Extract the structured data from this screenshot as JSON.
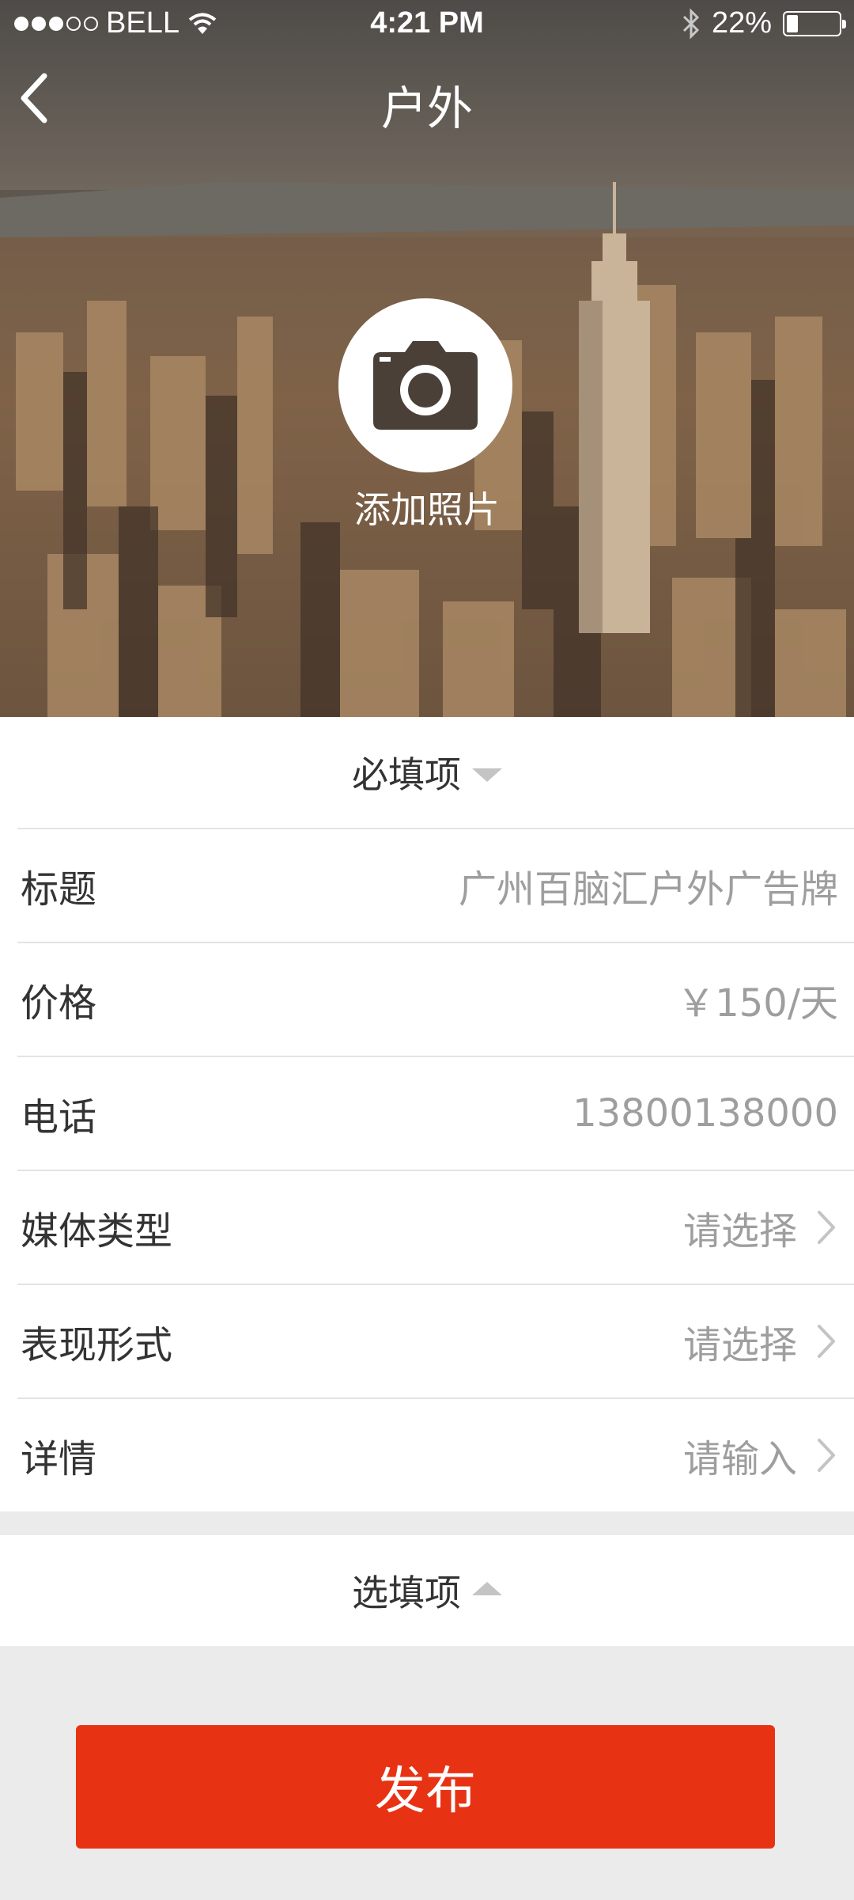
{
  "status_bar": {
    "carrier": "BELL",
    "time": "4:21 PM",
    "battery_text": "22%",
    "battery_level": 0.22,
    "signal_bars": 3,
    "icons": [
      "signal-dots-icon",
      "wifi-icon",
      "bluetooth-icon",
      "battery-icon"
    ]
  },
  "nav": {
    "title": "户外",
    "back_icon": "chevron-left-icon"
  },
  "photo": {
    "add_label": "添加照片",
    "icon": "camera-icon"
  },
  "required_section": {
    "title": "必填项",
    "toggle_icon": "triangle-down-icon",
    "fields": [
      {
        "label": "标题",
        "value": "广州百脑汇户外广告牌",
        "has_arrow": false
      },
      {
        "label": "价格",
        "value": "￥150/天",
        "has_arrow": false
      },
      {
        "label": "电话",
        "value": "13800138000",
        "has_arrow": false
      },
      {
        "label": "媒体类型",
        "value": "请选择",
        "has_arrow": true
      },
      {
        "label": "表现形式",
        "value": "请选择",
        "has_arrow": true
      },
      {
        "label": "详情",
        "value": "请输入",
        "has_arrow": true
      }
    ]
  },
  "optional_section": {
    "title": "选填项",
    "toggle_icon": "triangle-up-icon"
  },
  "publish_button": "发布",
  "colors": {
    "accent": "#e83214",
    "text_primary": "#333333",
    "text_secondary": "#9e9e9e",
    "background": "#ebebeb"
  }
}
